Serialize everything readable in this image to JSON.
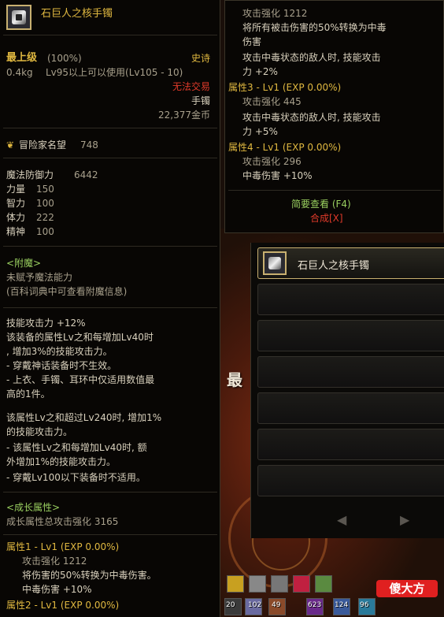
{
  "item": {
    "name": "石巨人之核手镯",
    "rarity": "最上级",
    "rarity_pct": "(100%)",
    "grade": "史诗",
    "weight": "0.4kg",
    "level_req": "Lv95以上可以使用(Lv105 - 10)",
    "trade": "无法交易",
    "type": "手镯",
    "price": "22,377金币",
    "fame_label": "冒险家名望",
    "fame_value": "748",
    "stats": [
      {
        "label": "魔法防御力",
        "value": "6442"
      },
      {
        "label": "力量",
        "value": "150"
      },
      {
        "label": "智力",
        "value": "100"
      },
      {
        "label": "体力",
        "value": "222"
      },
      {
        "label": "精神",
        "value": "100"
      }
    ],
    "enchant_header": "<附魔>",
    "enchant_line1": "未赋予魔法能力",
    "enchant_line2": "(百科词典中可查看附魔信息)",
    "skill_lines": [
      "技能攻击力 +12%",
      "该装备的属性Lv之和每增加Lv40时",
      ", 增加3%的技能攻击力。",
      "- 穿戴神话装备时不生效。",
      "- 上衣、手镯、耳环中仅适用数值最",
      "高的1件。"
    ],
    "skill_lines2": [
      "该属性Lv之和超过Lv240时, 增加1%",
      "的技能攻击力。",
      "- 该属性Lv之和每增加Lv40时, 额",
      "外增加1%的技能攻击力。",
      "- 穿戴Lv100以下装备时不适用。"
    ],
    "growth_header": "<成长属性>",
    "growth_total": "成长属性总攻击强化 3165",
    "attr1_title": "属性1 - Lv1 (EXP 0.00%)",
    "attr1_lines": [
      "攻击强化 1212",
      "将伤害的50%转换为中毒伤害。",
      "中毒伤害 +10%"
    ],
    "attr2_title": "属性2 - Lv1 (EXP 0.00%)"
  },
  "right_tooltip": {
    "lines_top": [
      "攻击强化 1212",
      "将所有被击伤害的50%转换为中毒",
      "伤害",
      "攻击中毒状态的敌人时, 技能攻击",
      "力 +2%"
    ],
    "attr3_title": "属性3 - Lv1 (EXP 0.00%)",
    "attr3_lines": [
      "攻击强化 445",
      "攻击中毒状态的敌人时, 技能攻击",
      "力 +5%"
    ],
    "attr4_title": "属性4 - Lv1 (EXP 0.00%)",
    "attr4_lines": [
      "攻击强化 296",
      "中毒伤害 +10%"
    ],
    "brief_view": "简要查看 (F4)",
    "synthesize": "合成[X]"
  },
  "inventory": {
    "first_slot_label": "石巨人之核手镯"
  },
  "background_char": "最",
  "quickbar": {
    "nums": [
      "20",
      "102",
      "49",
      "623",
      "124",
      "96"
    ]
  },
  "watermark": "傻大方",
  "colors": {
    "gold": "#e0b840",
    "red": "#e03a2a",
    "green": "#9ad060"
  }
}
